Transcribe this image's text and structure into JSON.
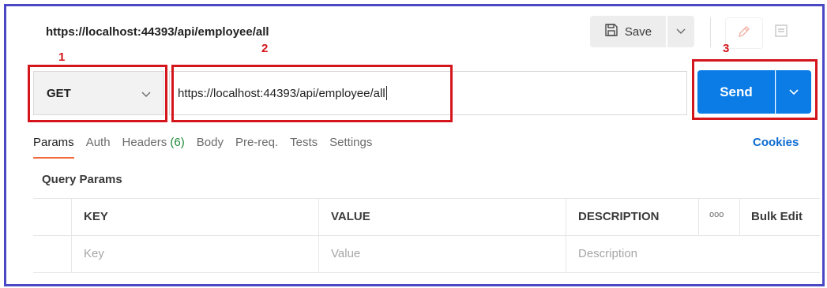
{
  "request": {
    "title_url": "https://localhost:44393/api/employee/all",
    "method": "GET",
    "url": "https://localhost:44393/api/employee/all"
  },
  "toolbar": {
    "save_label": "Save",
    "send_label": "Send"
  },
  "annotations": {
    "one": "1",
    "two": "2",
    "three": "3",
    "color": "#d4161c"
  },
  "tabs": [
    {
      "label": "Params",
      "active": true
    },
    {
      "label": "Auth"
    },
    {
      "label": "Headers",
      "count": "(6)"
    },
    {
      "label": "Body"
    },
    {
      "label": "Pre-req."
    },
    {
      "label": "Tests"
    },
    {
      "label": "Settings"
    }
  ],
  "cookies_label": "Cookies",
  "query_params": {
    "title": "Query Params",
    "columns": {
      "key": "KEY",
      "value": "VALUE",
      "description": "DESCRIPTION",
      "more": "ooo",
      "bulk_edit": "Bulk Edit"
    },
    "placeholders": {
      "key": "Key",
      "value": "Value",
      "description": "Description"
    }
  },
  "colors": {
    "frame": "#4a48c4",
    "send": "#0b7ce6",
    "cookies": "#0b6bd1",
    "active_tab": "#f26b3a",
    "header_count": "#1f8a3a"
  },
  "icons": [
    "save-icon",
    "chevron-down-icon",
    "pencil-icon",
    "comment-icon",
    "more-icon"
  ]
}
